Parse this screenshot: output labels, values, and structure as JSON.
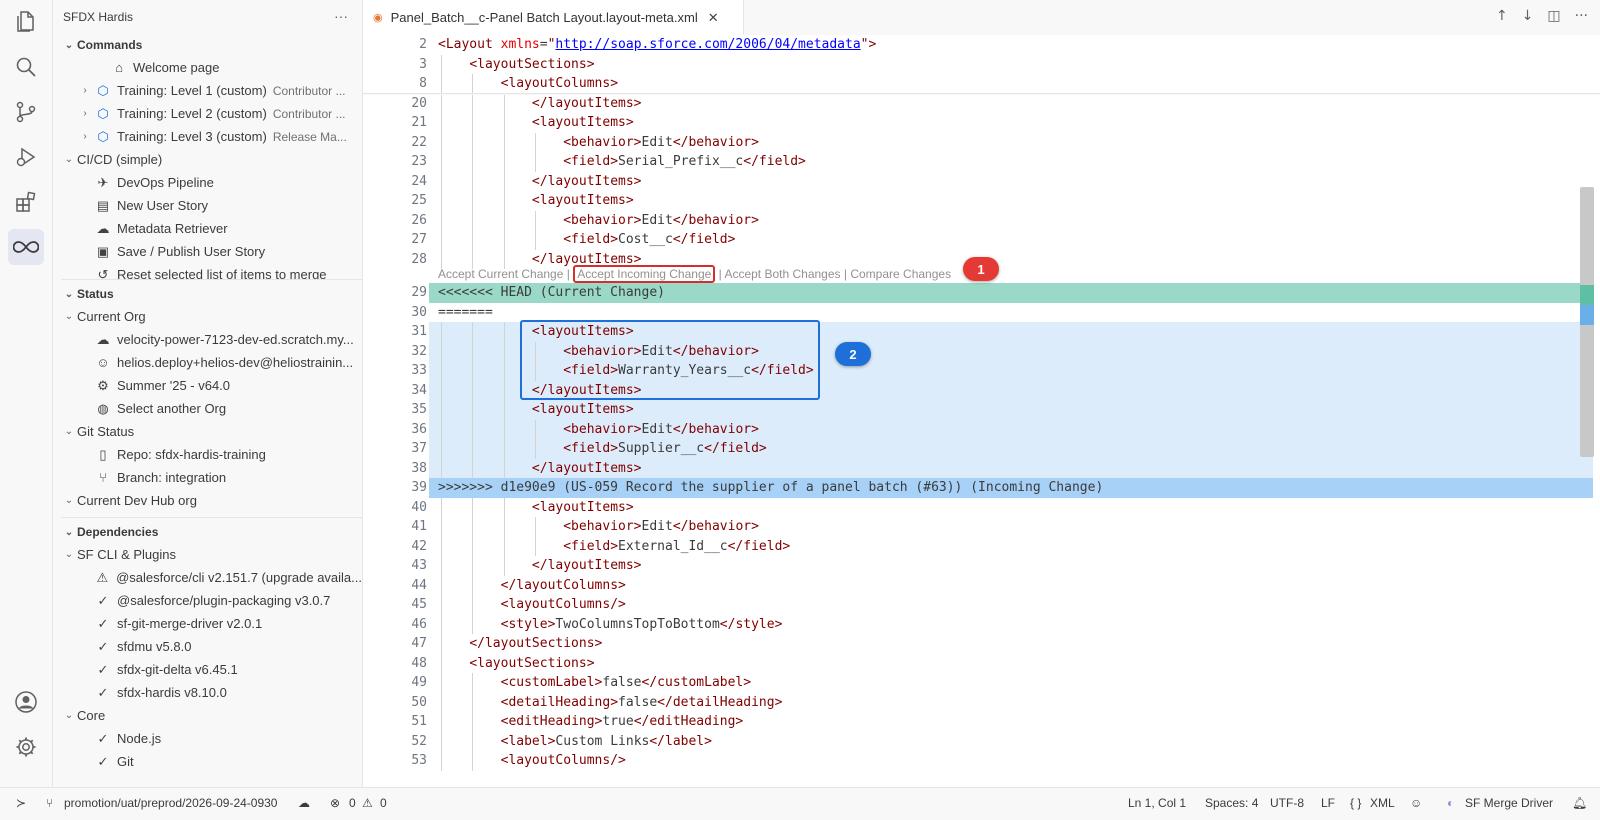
{
  "sidebar": {
    "title": "SFDX Hardis",
    "more": "···",
    "commands": {
      "header": "Commands",
      "items": [
        {
          "label": "Welcome page",
          "desc": "",
          "icon": "welcome-icon",
          "indent": 2,
          "chev": ""
        },
        {
          "label": "Training: Level 1 (custom)",
          "desc": "Contributor ...",
          "icon": "mortarboard-icon",
          "indent": 1,
          "chev": "›"
        },
        {
          "label": "Training: Level 2 (custom)",
          "desc": "Contributor ...",
          "icon": "mortarboard-icon",
          "indent": 1,
          "chev": "›"
        },
        {
          "label": "Training: Level 3 (custom)",
          "desc": "Release Ma...",
          "icon": "mortarboard-icon",
          "indent": 1,
          "chev": "›"
        },
        {
          "label": "CI/CD (simple)",
          "desc": "",
          "icon": "",
          "indent": 0,
          "chev": "⌄"
        },
        {
          "label": "DevOps Pipeline",
          "desc": "",
          "icon": "rocket-icon",
          "indent": 1,
          "chev": ""
        },
        {
          "label": "New User Story",
          "desc": "",
          "icon": "new-file-icon",
          "indent": 1,
          "chev": ""
        },
        {
          "label": "Metadata Retriever",
          "desc": "",
          "icon": "cloud-download-icon",
          "indent": 1,
          "chev": ""
        },
        {
          "label": "Save / Publish User Story",
          "desc": "",
          "icon": "save-icon",
          "indent": 1,
          "chev": ""
        },
        {
          "label": "Reset selected list of items to merge",
          "desc": "",
          "icon": "history-icon",
          "indent": 1,
          "chev": ""
        }
      ]
    },
    "status": {
      "header": "Status",
      "items": [
        {
          "label": "Current Org",
          "icon": "",
          "indent": 0,
          "chev": "⌄"
        },
        {
          "label": "velocity-power-7123-dev-ed.scratch.my...",
          "icon": "cloud-icon",
          "indent": 1,
          "chev": ""
        },
        {
          "label": "helios.deploy+helios-dev@heliostrainin...",
          "icon": "account-icon",
          "indent": 1,
          "chev": ""
        },
        {
          "label": "Summer '25 - v64.0",
          "icon": "gear-icon",
          "indent": 1,
          "chev": ""
        },
        {
          "label": "Select another Org",
          "icon": "globe-icon",
          "indent": 1,
          "chev": ""
        },
        {
          "label": "Git Status",
          "icon": "",
          "indent": 0,
          "chev": "⌄"
        },
        {
          "label": "Repo: sfdx-hardis-training",
          "icon": "repo-icon",
          "indent": 1,
          "chev": ""
        },
        {
          "label": "Branch: integration",
          "icon": "branch-icon",
          "indent": 1,
          "chev": ""
        },
        {
          "label": "Current Dev Hub org",
          "icon": "",
          "indent": 0,
          "chev": "⌄"
        }
      ]
    },
    "dependencies": {
      "header": "Dependencies",
      "items": [
        {
          "label": "SF CLI & Plugins",
          "icon": "",
          "indent": 0,
          "chev": "⌄"
        },
        {
          "label": "@salesforce/cli v2.151.7 (upgrade availa...",
          "icon": "warning-icon",
          "indent": 1,
          "chev": ""
        },
        {
          "label": "@salesforce/plugin-packaging v3.0.7",
          "icon": "check-icon",
          "indent": 1,
          "chev": ""
        },
        {
          "label": "sf-git-merge-driver v2.0.1",
          "icon": "check-icon",
          "indent": 1,
          "chev": ""
        },
        {
          "label": "sfdmu v5.8.0",
          "icon": "check-icon",
          "indent": 1,
          "chev": ""
        },
        {
          "label": "sfdx-git-delta v6.45.1",
          "icon": "check-icon",
          "indent": 1,
          "chev": ""
        },
        {
          "label": "sfdx-hardis v8.10.0",
          "icon": "check-icon",
          "indent": 1,
          "chev": ""
        },
        {
          "label": "Core",
          "icon": "",
          "indent": 0,
          "chev": "⌄"
        },
        {
          "label": "Node.js",
          "icon": "check-icon",
          "indent": 1,
          "chev": ""
        },
        {
          "label": "Git",
          "icon": "check-icon",
          "indent": 1,
          "chev": ""
        }
      ]
    }
  },
  "tab": {
    "title": "Panel_Batch__c-Panel Batch Layout.layout-meta.xml",
    "close": "✕"
  },
  "codelens": {
    "accept_current": "Accept Current Change",
    "accept_incoming": "Accept Incoming Change",
    "accept_both": "Accept Both Changes",
    "separator": "|",
    "compare": "Compare Changes"
  },
  "badges": {
    "one": "1",
    "two": "2"
  },
  "statusbar": {
    "branch": "promotion/uat/preprod/2026-09-24-0930",
    "errors": "0",
    "warnings": "0",
    "position": "Ln 1, Col 1",
    "spaces": "Spaces: 4",
    "encoding": "UTF-8",
    "eol": "LF",
    "language": "XML",
    "merge_driver": "SF Merge Driver"
  }
}
